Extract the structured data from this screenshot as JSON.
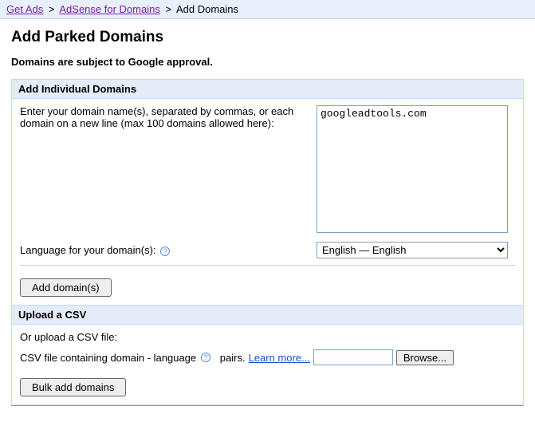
{
  "breadcrumb": {
    "items": [
      "Get Ads",
      "AdSense for Domains",
      "Add Domains"
    ],
    "sep": ">"
  },
  "page_title": "Add Parked Domains",
  "approval_note": "Domains are subject to Google approval.",
  "individual": {
    "header": "Add Individual Domains",
    "instruction": "Enter your domain name(s), separated by commas, or each domain on a new line (max 100 domains allowed here):",
    "domains_value": "googleadtools.com",
    "language_label": "Language for your domain(s):",
    "language_selected": "English — English",
    "add_button": "Add domain(s)"
  },
  "csv": {
    "header": "Upload a CSV",
    "or_upload": "Or upload a CSV file:",
    "label_prefix": "CSV file containing domain - language",
    "label_suffix": "pairs.",
    "learn_more": "Learn more...",
    "browse": "Browse...",
    "bulk_button": "Bulk add domains"
  },
  "help_glyph": "?"
}
